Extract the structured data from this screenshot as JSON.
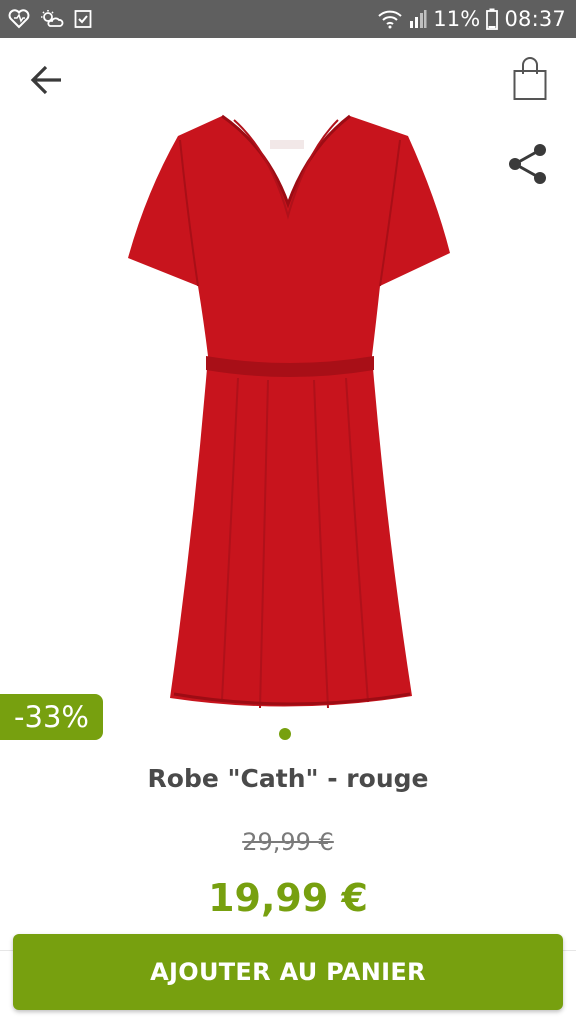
{
  "status_bar": {
    "battery": "11%",
    "time": "08:37",
    "left_icons": [
      "heart-icon",
      "weather-icon",
      "checklist-icon"
    ],
    "right_icons": [
      "wifi-icon",
      "signal-icon",
      "battery-icon"
    ]
  },
  "header": {
    "icons": [
      "back-arrow-icon",
      "shopping-bag-icon",
      "share-icon"
    ]
  },
  "product": {
    "image": "red-dress-image",
    "badge": "-33%",
    "title": "Robe \"Cath\" - rouge",
    "old_price": "29,99 €",
    "price": "19,99 €",
    "pager_dots": 1,
    "active_dot": 1
  },
  "cta": {
    "label": "AJOUTER AU PANIER"
  },
  "colors": {
    "accent": "#77a00f",
    "status_bar": "#5f5f5f",
    "dress": "#c8141d",
    "text": "#4a4a4a"
  }
}
